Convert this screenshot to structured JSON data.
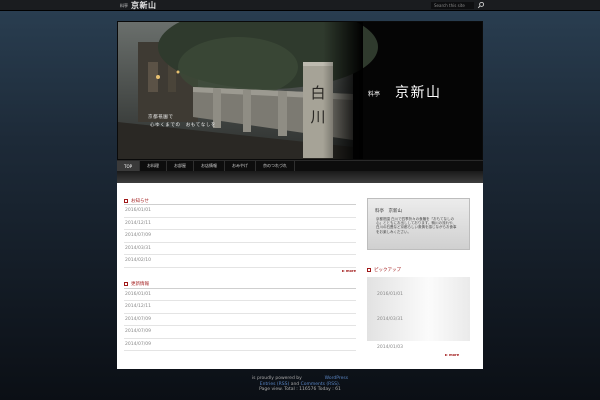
{
  "topbar": {
    "brand_prefix": "料亭",
    "brand_name": "京新山",
    "search_placeholder": "Search this site"
  },
  "header": {
    "caption_line1": "京都祇園で",
    "caption_line2": "心ゆくまでの　おもてなしを",
    "shop_prefix": "料亭",
    "shop_name": "京新山",
    "pillar_text": "白川"
  },
  "nav": {
    "items": [
      {
        "label": "TOP",
        "active": true
      },
      {
        "label": "お料理"
      },
      {
        "label": "お部屋"
      },
      {
        "label": "お店情報"
      },
      {
        "label": "おみやげ"
      },
      {
        "label": "京のつれづれ"
      }
    ]
  },
  "news": {
    "title": "お知らせ",
    "dates": [
      "2016/01/01",
      "2014/12/11",
      "2014/07/09",
      "2014/03/31",
      "2014/02/10"
    ],
    "more": "more"
  },
  "updates": {
    "title": "更新情報",
    "dates": [
      "2016/01/01",
      "2014/12/11",
      "2014/07/09",
      "2014/07/09",
      "2014/07/09"
    ]
  },
  "sidebar": {
    "about_title": "料亭　京新山",
    "about_text": "京都祇園 白川で四季折々の食膳を「おもてなしの心」とともにお出ししております。鴨川の流れや、白川の石畳など京都らしい風情を感じながらお食事をお楽しみください。",
    "pickup_title": "ピックアップ",
    "pickup_dates": [
      "2016/01/01",
      "2014/03/31",
      "2014/01/03"
    ],
    "more": "more"
  },
  "footer": {
    "powered_prefix": "is proudly powered by",
    "powered_link": "WordPress",
    "entries_link": "Entries (RSS)",
    "and": "and",
    "comments_link": "Comments (RSS).",
    "pageview": "Page view. Total : 116576 Today : 61"
  }
}
